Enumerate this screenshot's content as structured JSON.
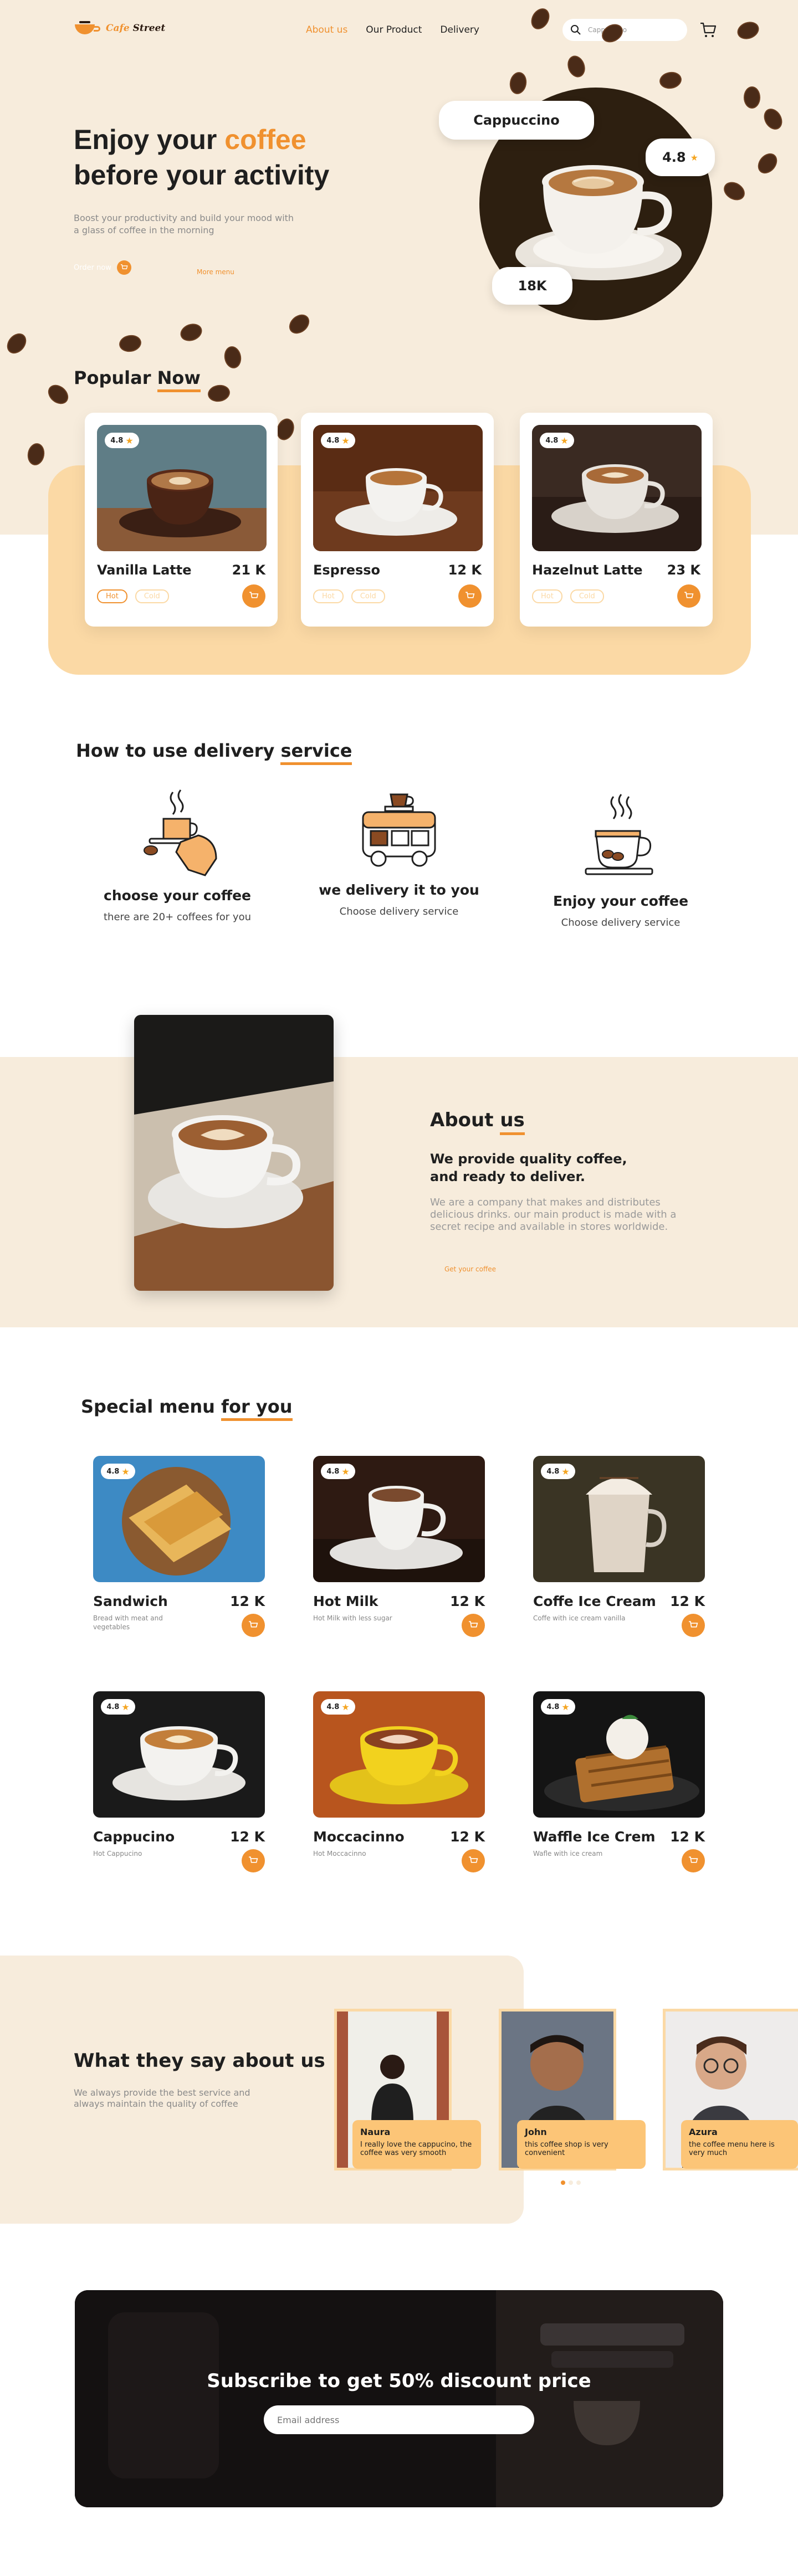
{
  "nav": {
    "logo_part1": "Cafe",
    "logo_part2": "Street",
    "links": [
      "About us",
      "Our Product",
      "Delivery"
    ],
    "search_value": "Cappuccino",
    "colors": {
      "accent": "#f0912f",
      "cream": "#f7ecdc",
      "peach": "#fbd9a5"
    }
  },
  "hero": {
    "title_line1_a": "Enjoy your ",
    "title_line1_b": "coffee",
    "title_line2": "before your activity",
    "subtitle": "Boost your productivity and build your mood with a glass of coffee in the morning",
    "order_label": "Order now",
    "more_label": "More menu",
    "badge_name": "Cappuccino",
    "badge_rating": "4.8",
    "badge_count": "18K"
  },
  "popular": {
    "title_a": "Popular ",
    "title_b": "Now",
    "items": [
      {
        "name": "Vanilla Latte",
        "price": "21 K",
        "rating": "4.8",
        "hot": "Hot",
        "cold": "Cold"
      },
      {
        "name": "Espresso",
        "price": "12 K",
        "rating": "4.8",
        "hot": "Hot",
        "cold": "Cold"
      },
      {
        "name": "Hazelnut Latte",
        "price": "23 K",
        "rating": "4.8",
        "hot": "Hot",
        "cold": "Cold"
      }
    ]
  },
  "how": {
    "title_a": "How to use delivery ",
    "title_b": "service",
    "steps": [
      {
        "title": "choose your coffee",
        "desc": "there are 20+ coffees for you"
      },
      {
        "title": "we delivery it to you",
        "desc": "Choose delivery service"
      },
      {
        "title": "Enjoy your coffee",
        "desc": "Choose delivery service"
      }
    ]
  },
  "about": {
    "title_a": "About ",
    "title_b": "us",
    "heading_line1": "We provide quality coffee,",
    "heading_line2": "and ready to deliver.",
    "text": "We are a company that makes and distributes delicious drinks. our main product is made with a secret recipe and available in stores worldwide.",
    "link": "Get your coffee"
  },
  "special": {
    "title_a": "Special menu ",
    "title_b": "for you",
    "items": [
      {
        "name": "Sandwich",
        "price": "12 K",
        "rating": "4.8",
        "desc": "Bread with meat and vegetables"
      },
      {
        "name": "Hot Milk",
        "price": "12 K",
        "rating": "4.8",
        "desc": "Hot Milk with less sugar"
      },
      {
        "name": "Coffe Ice Cream",
        "price": "12 K",
        "rating": "4.8",
        "desc": "Coffe with ice cream vanilla"
      },
      {
        "name": "Cappucino",
        "price": "12 K",
        "rating": "4.8",
        "desc": "Hot Cappucino"
      },
      {
        "name": "Moccacinno",
        "price": "12 K",
        "rating": "4.8",
        "desc": "Hot Moccacinno"
      },
      {
        "name": "Waffle Ice Crem",
        "price": "12 K",
        "rating": "4.8",
        "desc": "Wafle with ice cream"
      }
    ]
  },
  "testimonials": {
    "title": "What they say about us",
    "subtitle": "We always provide the best service and always maintain the quality of coffee",
    "items": [
      {
        "name": "Naura",
        "quote": "I really love the cappucino, the coffee was very smooth"
      },
      {
        "name": "John",
        "quote": "this coffee shop is very convenient"
      },
      {
        "name": "Azura",
        "quote": "the coffee menu here is very much"
      }
    ]
  },
  "subscribe": {
    "title": "Subscribe to get 50% discount price",
    "placeholder": "Email address"
  }
}
